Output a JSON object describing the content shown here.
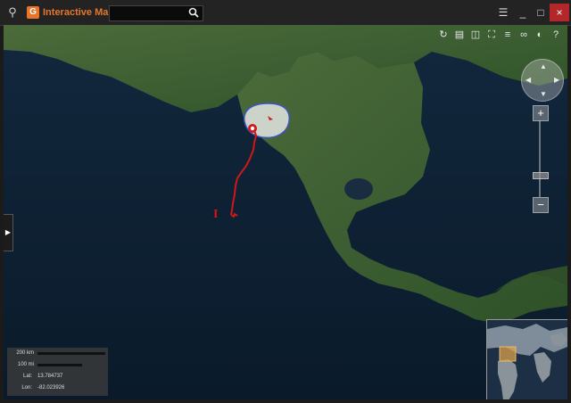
{
  "window": {
    "title": "Interactive Map"
  },
  "search": {
    "placeholder": "",
    "value": ""
  },
  "map": {
    "scale": {
      "km_label": "200 km",
      "mi_label": "100 mi"
    },
    "coords": {
      "lat_label": "Lat:",
      "lat_value": "13.784737",
      "lon_label": "Lon:",
      "lon_value": "-82.023926"
    },
    "track_label": "I",
    "colors": {
      "track": "#d01818",
      "ocean": "#0b1d2e",
      "cone_fill": "#d8dcd6",
      "cone_edge": "#3f52c7"
    }
  },
  "zoom": {
    "plus_label": "+",
    "minus_label": "−"
  }
}
